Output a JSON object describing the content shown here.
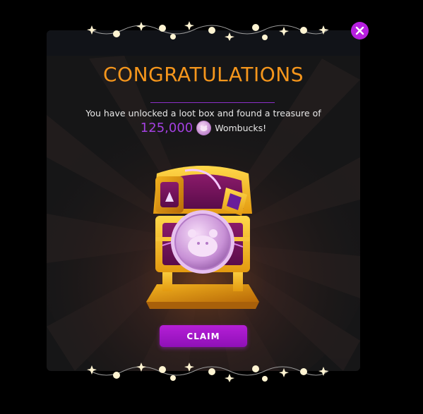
{
  "dialog": {
    "title": "CONGRATULATIONS",
    "message": "You have unlocked a loot box and found a treasure of",
    "reward_amount": "125,000",
    "currency_name": "Wombucks!",
    "currency_icon": "wombuck-coin-icon",
    "claim_label": "CLAIM",
    "close_icon": "close-icon"
  },
  "theme": {
    "background": "#000000",
    "panel": "#161617",
    "title_orange": "#f5961c",
    "accent_purple": "#b51fd6",
    "amount_purple": "#a340e0",
    "text": "#e8e8e8"
  },
  "decorations": {
    "string_lights": "string-lights-decoration",
    "loot_box": "golden-loot-chest-with-wombuck-coin"
  }
}
